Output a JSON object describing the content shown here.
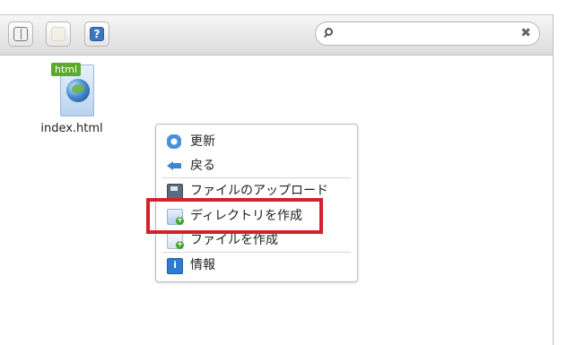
{
  "toolbar": {
    "buttons": [
      {
        "icon": "book-icon"
      },
      {
        "icon": "lock-icon"
      },
      {
        "icon": "help-icon",
        "glyph": "?"
      }
    ],
    "search": {
      "value": "",
      "placeholder": "",
      "icon": "search-icon",
      "clear_icon": "close-icon",
      "clear_glyph": "✖"
    }
  },
  "files": [
    {
      "name": "index.html",
      "badge": "html",
      "icon": "html-file-icon"
    }
  ],
  "context_menu": {
    "items": [
      {
        "label": "更新",
        "icon": "reload-icon"
      },
      {
        "label": "戻る",
        "icon": "back-arrow-icon"
      },
      {
        "label": "ファイルのアップロード",
        "icon": "upload-icon"
      },
      {
        "label": "ディレクトリを作成",
        "icon": "new-directory-icon"
      },
      {
        "label": "ファイルを作成",
        "icon": "new-file-icon"
      },
      {
        "label": "情報",
        "icon": "info-icon",
        "glyph": "i"
      }
    ]
  },
  "colors": {
    "highlight": "#d4222a",
    "accent": "#3a78c2"
  }
}
